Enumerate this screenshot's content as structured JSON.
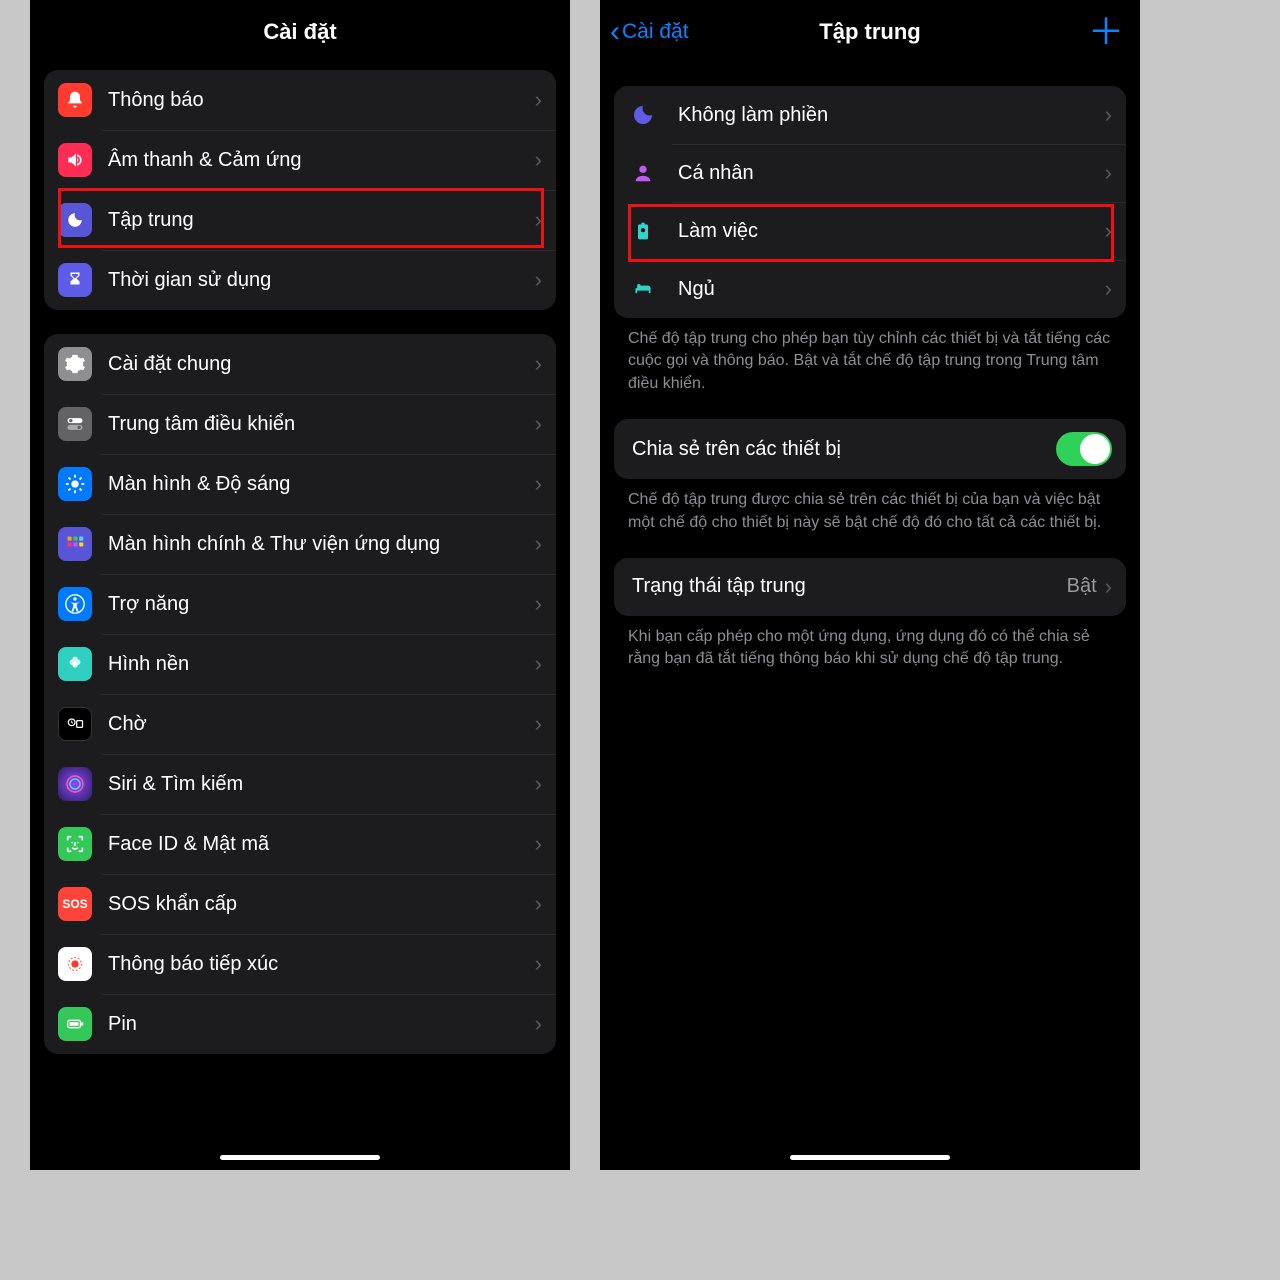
{
  "left": {
    "title": "Cài đặt",
    "group1": [
      {
        "label": "Thông báo"
      },
      {
        "label": "Âm thanh & Cảm ứng"
      },
      {
        "label": "Tập trung"
      },
      {
        "label": "Thời gian sử dụng"
      }
    ],
    "group2": [
      {
        "label": "Cài đặt chung"
      },
      {
        "label": "Trung tâm điều khiển"
      },
      {
        "label": "Màn hình & Độ sáng"
      },
      {
        "label": "Màn hình chính & Thư viện ứng dụng"
      },
      {
        "label": "Trợ năng"
      },
      {
        "label": "Hình nền"
      },
      {
        "label": "Chờ"
      },
      {
        "label": "Siri & Tìm kiếm"
      },
      {
        "label": "Face ID & Mật mã"
      },
      {
        "label": "SOS khẩn cấp"
      },
      {
        "label": "Thông báo tiếp xúc"
      },
      {
        "label": "Pin"
      }
    ]
  },
  "right": {
    "back": "Cài đặt",
    "title": "Tập trung",
    "modes": [
      {
        "label": "Không làm phiền"
      },
      {
        "label": "Cá nhân"
      },
      {
        "label": "Làm việc"
      },
      {
        "label": "Ngủ"
      }
    ],
    "desc1": "Chế độ tập trung cho phép bạn tùy chỉnh các thiết bị và tắt tiếng các cuộc gọi và thông báo. Bật và tắt chế độ tập trung trong Trung tâm điều khiển.",
    "share_label": "Chia sẻ trên các thiết bị",
    "desc2": "Chế độ tập trung được chia sẻ trên các thiết bị của bạn và việc bật một chế độ cho thiết bị này sẽ bật chế độ đó cho tất cả các thiết bị.",
    "status_label": "Trạng thái tập trung",
    "status_value": "Bật",
    "desc3": "Khi bạn cấp phép cho một ứng dụng, ứng dụng đó có thể chia sẻ rằng bạn đã tắt tiếng thông báo khi sử dụng chế độ tập trung."
  }
}
